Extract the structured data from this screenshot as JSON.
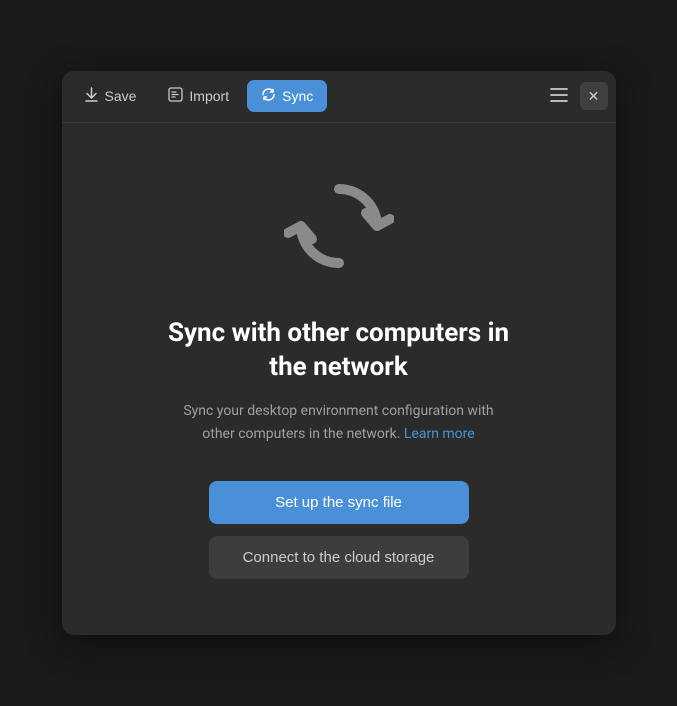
{
  "toolbar": {
    "save_label": "Save",
    "import_label": "Import",
    "sync_label": "Sync"
  },
  "main": {
    "title": "Sync with other computers in the network",
    "description_text": "Sync your desktop environment configuration with other computers in the network.",
    "learn_more_label": "Learn more",
    "btn_primary_label": "Set up the sync file",
    "btn_secondary_label": "Connect to the cloud storage"
  },
  "icons": {
    "save": "⬇",
    "import": "📁",
    "sync": "🔄",
    "menu": "☰",
    "close": "✕"
  }
}
